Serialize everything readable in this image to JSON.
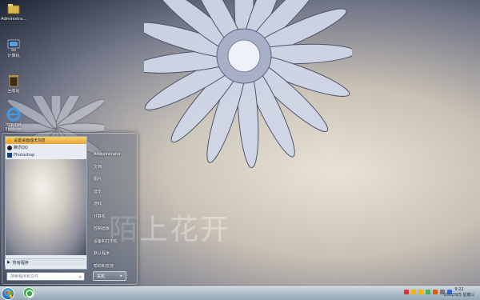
{
  "desktop": {
    "wallpaper_text": "陌上花开",
    "icons": [
      {
        "name": "admin",
        "label": "Administra..."
      },
      {
        "name": "computer",
        "label": "计算机"
      },
      {
        "name": "recycle",
        "label": "回收站"
      },
      {
        "name": "ie",
        "label": "Internet Explorer"
      }
    ]
  },
  "start_menu": {
    "pinned": [
      {
        "label": "设置桌面成IE浏览"
      },
      {
        "label": "腾讯QQ"
      },
      {
        "label": "Photoshop"
      }
    ],
    "all_programs": "所有程序",
    "search_placeholder": "搜索程序和文件",
    "right_items": [
      "Administrator",
      "文档",
      "图片",
      "音乐",
      "游戏",
      "计算机",
      "控制面板",
      "设备和打印机",
      "默认程序",
      "帮助和支持"
    ],
    "shutdown_label": "关机",
    "shutdown_arrow": "▸"
  },
  "taskbar": {
    "clock_time": "9:22",
    "clock_date": "2012/9/5 星期三"
  },
  "colors": {
    "taskbar": "#b3c1cd",
    "tray_icons": [
      "#d33",
      "#f5b400",
      "#f5b400",
      "#4caf50",
      "#e05a00",
      "#777",
      "#2a6bd1"
    ]
  }
}
